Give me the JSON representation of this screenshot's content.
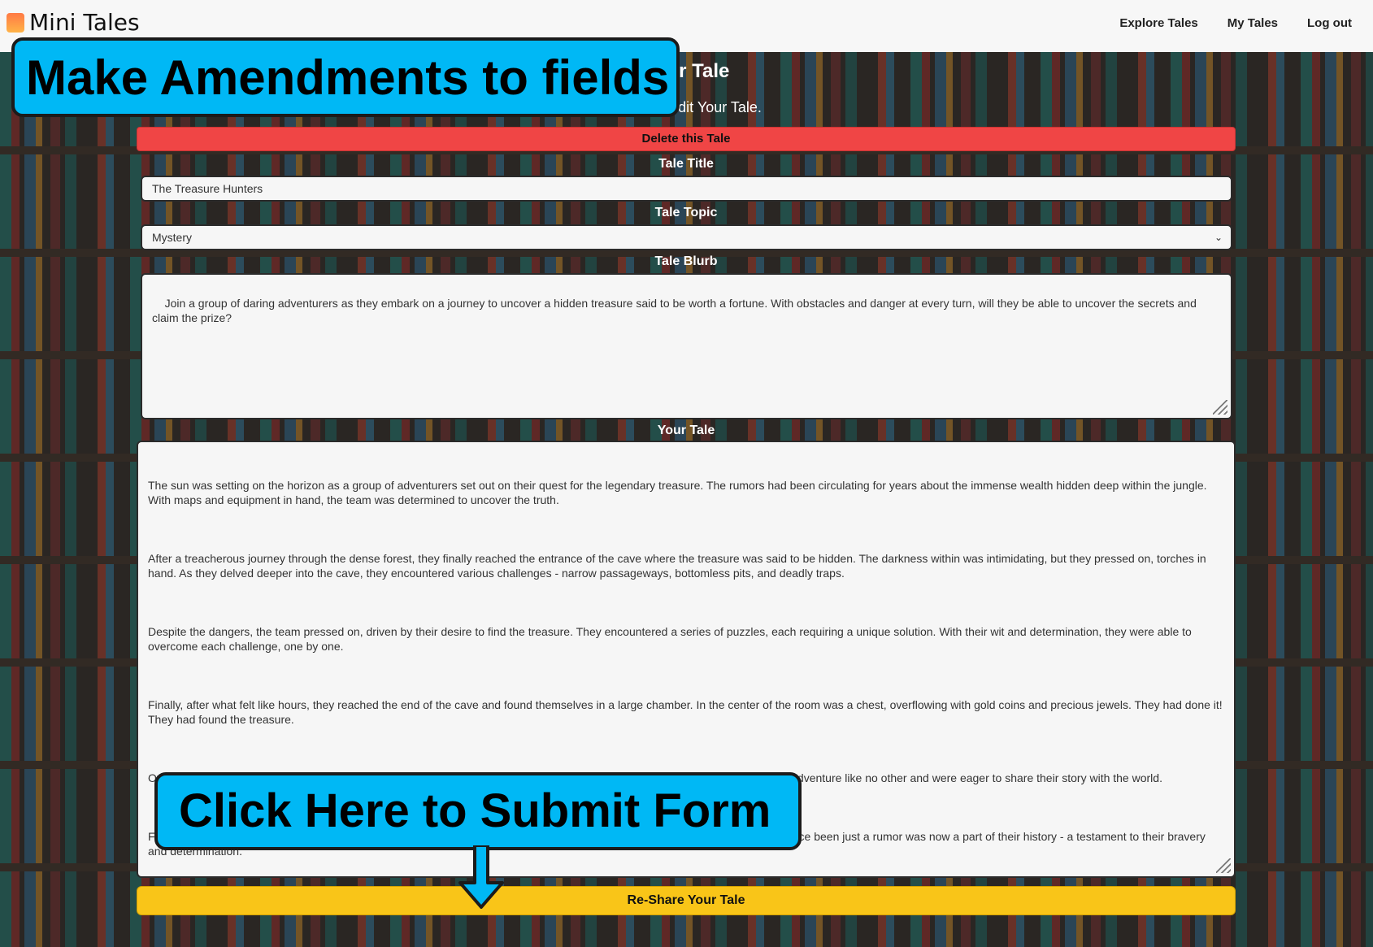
{
  "app": {
    "name": "Mini Tales"
  },
  "nav": {
    "links": [
      "Explore Tales",
      "My Tales",
      "Log out"
    ]
  },
  "page": {
    "title": "Your Tale",
    "subtitle": "below to edit Your Tale."
  },
  "form": {
    "delete_label": "Delete this Tale",
    "title_label": "Tale Title",
    "title_value": "The Treasure Hunters",
    "topic_label": "Tale Topic",
    "topic_value": "Mystery",
    "blurb_label": "Tale Blurb",
    "blurb_value": "Join a group of daring adventurers as they embark on a journey to uncover a hidden treasure said to be worth a fortune. With obstacles and danger at every turn, will they be able to uncover the secrets and claim the prize?",
    "tale_label": "Your Tale",
    "tale_paragraphs": [
      "The sun was setting on the horizon as a group of adventurers set out on their quest for the legendary treasure. The rumors had been circulating for years about the immense wealth hidden deep within the jungle. With maps and equipment in hand, the team was determined to uncover the truth.",
      "After a treacherous journey through the dense forest, they finally reached the entrance of the cave where the treasure was said to be hidden. The darkness within was intimidating, but they pressed on, torches in hand. As they delved deeper into the cave, they encountered various challenges - narrow passageways, bottomless pits, and deadly traps.",
      "Despite the dangers, the team pressed on, driven by their desire to find the treasure. They encountered a series of puzzles, each requiring a unique solution. With their wit and determination, they were able to overcome each challenge, one by one.",
      "Finally, after what felt like hours, they reached the end of the cave and found themselves in a large chamber. In the center of the room was a chest, overflowing with gold coins and precious jewels. They had done it! They had found the treasure.",
      "Overjoyed and exhausted, the team made their way back to civilization, their pockets overflowing with riches. They had lived an adventure like no other and were eager to share their story with the world.",
      "From that day on, they lived a life of luxury, traveling the world and having exciting new experiences. And the treasure that had once been just a rumor was now a part of their history - a testament to their bravery and determination."
    ],
    "submit_label": "Re-Share Your Tale"
  },
  "callouts": {
    "top": "Make Amendments to fields",
    "bottom": "Click Here to Submit Form"
  },
  "colors": {
    "delete": "#f04545",
    "submit": "#f9c518",
    "callout": "#00b8f5"
  }
}
